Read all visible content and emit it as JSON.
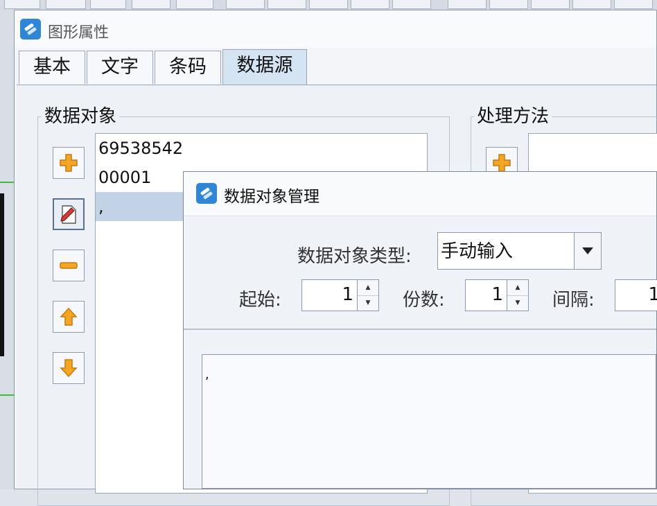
{
  "window": {
    "title": "图形属性"
  },
  "tabs": [
    {
      "label": "基本",
      "active": false
    },
    {
      "label": "文字",
      "active": false
    },
    {
      "label": "条码",
      "active": false
    },
    {
      "label": "数据源",
      "active": true
    }
  ],
  "data_objects": {
    "group_label": "数据对象",
    "items": [
      "69538542",
      "00001",
      ","
    ],
    "selected_index": 2,
    "buttons": [
      "add-icon",
      "edit-icon",
      "remove-icon",
      "move-up-icon",
      "move-down-icon"
    ]
  },
  "processing": {
    "group_label": "处理方法",
    "buttons": [
      "add-icon"
    ]
  },
  "dialog": {
    "title": "数据对象管理",
    "type_label": "数据对象类型:",
    "type_value": "手动输入",
    "start_label": "起始:",
    "start_value": "1",
    "copies_label": "份数:",
    "copies_value": "1",
    "interval_label": "间隔:",
    "interval_value": "1",
    "text_content": ","
  },
  "colors": {
    "accent": "#2f86d6",
    "selected_row": "#c2d3e8",
    "active_tab": "#d5e4f3",
    "add_orange": "#f2a623"
  }
}
